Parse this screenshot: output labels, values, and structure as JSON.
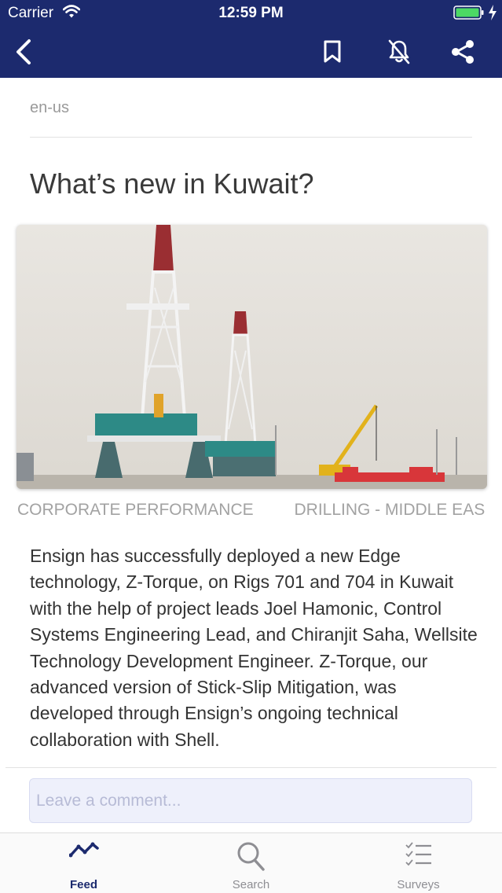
{
  "status_bar": {
    "carrier": "Carrier",
    "time": "12:59 PM",
    "battery_color": "#4cd964"
  },
  "nav": {
    "background": "#1c2a6e",
    "icons": [
      "back-chevron-icon",
      "bookmark-icon",
      "bell-off-icon",
      "share-icon"
    ]
  },
  "article": {
    "locale": "en-us",
    "title": "What’s new in Kuwait?",
    "tags": [
      "CORPORATE PERFORMANCE",
      "DRILLING - MIDDLE EAS"
    ],
    "body": "Ensign has successfully deployed a new Edge technology, Z-Torque, on Rigs 701 and 704 in Kuwait with the help of project leads Joel Hamonic, Control Systems Engineering Lead, and Chiranjit Saha, Wellsite Technology Development Engineer. Z-Torque, our advanced version of Stick-Slip Mitigation, was developed through Ensign’s ongoing technical collaboration with Shell."
  },
  "comment": {
    "placeholder": "Leave a comment..."
  },
  "tabbar": {
    "tabs": [
      {
        "label": "Feed",
        "icon": "activity-icon",
        "active": true
      },
      {
        "label": "Search",
        "icon": "search-icon",
        "active": false
      },
      {
        "label": "Surveys",
        "icon": "checklist-icon",
        "active": false
      }
    ],
    "active_color": "#1c2a6e",
    "inactive_color": "#8e8e93"
  }
}
